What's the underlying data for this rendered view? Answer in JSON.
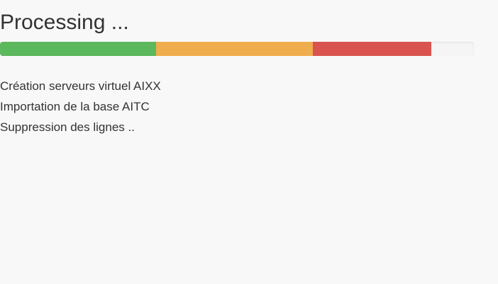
{
  "title": "Processing ...",
  "progress": {
    "segments": [
      {
        "name": "success",
        "percent": 33,
        "color": "#5cb85c"
      },
      {
        "name": "warning",
        "percent": 33,
        "color": "#f0ad4e"
      },
      {
        "name": "danger",
        "percent": 25,
        "color": "#d9534f"
      }
    ],
    "track_color": "#f5f5f5"
  },
  "steps": [
    "Création serveurs virtuel AIXX",
    "Importation de la base AITC",
    "Suppression des lignes .."
  ]
}
